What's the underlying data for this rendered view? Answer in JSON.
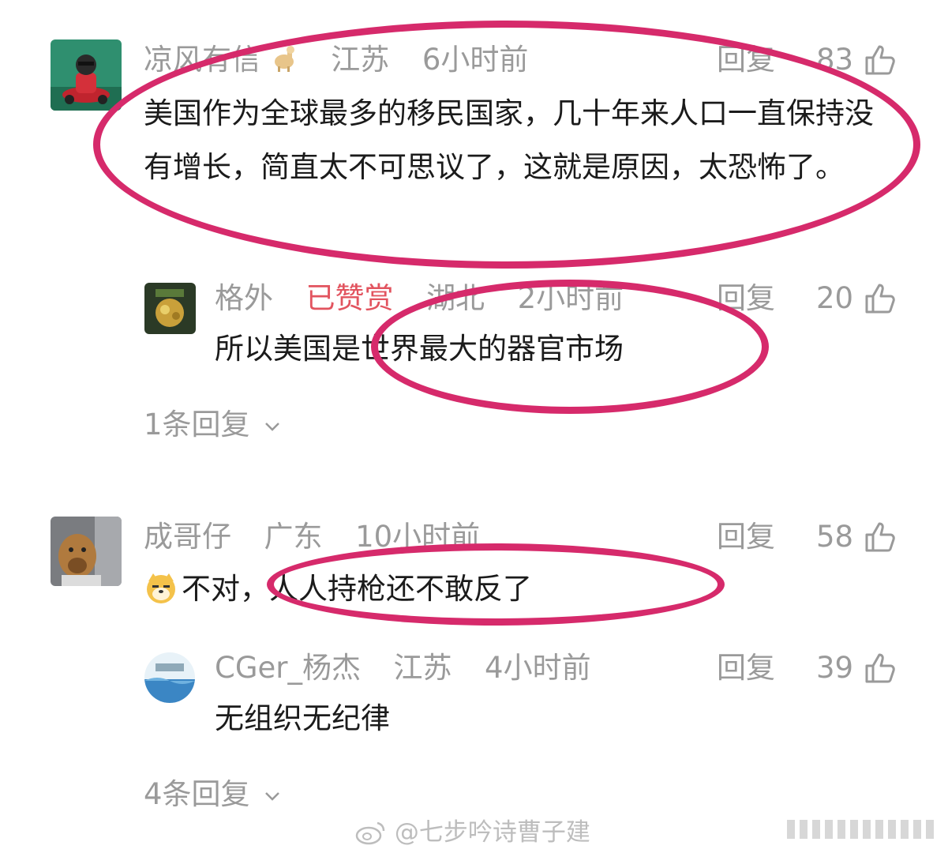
{
  "comments": [
    {
      "username": "凉风有信",
      "location": "江苏",
      "time": "6小时前",
      "reply_label": "回复",
      "likes": "83",
      "text": "美国作为全球最多的移民国家，几十年来人口一直保持没有增长，简直太不可思议了，这就是原因，太恐怖了。",
      "replies": [
        {
          "username": "格外",
          "badge": "已赞赏",
          "location": "湖北",
          "time": "2小时前",
          "reply_label": "回复",
          "likes": "20",
          "text": "所以美国是世界最大的器官市场"
        }
      ],
      "expand_label": "1条回复"
    },
    {
      "username": "成哥仔",
      "location": "广东",
      "time": "10小时前",
      "reply_label": "回复",
      "likes": "58",
      "text": "不对，人人持枪还不敢反了",
      "replies": [
        {
          "username": "CGer_杨杰",
          "location": "江苏",
          "time": "4小时前",
          "reply_label": "回复",
          "likes": "39",
          "text": "无组织无纪律"
        }
      ],
      "expand_label": "4条回复"
    }
  ],
  "watermark": "@七步吟诗曹子建",
  "colors": {
    "highlight_circle": "#d62a6b",
    "meta_gray": "#9a9a9a",
    "badge_red": "#e2545f"
  },
  "icons": {
    "like": "thumbs-up-icon",
    "expand": "chevron-down-icon",
    "emoji": "doge-emoji-icon",
    "watermark_logo": "weibo-logo-icon"
  }
}
